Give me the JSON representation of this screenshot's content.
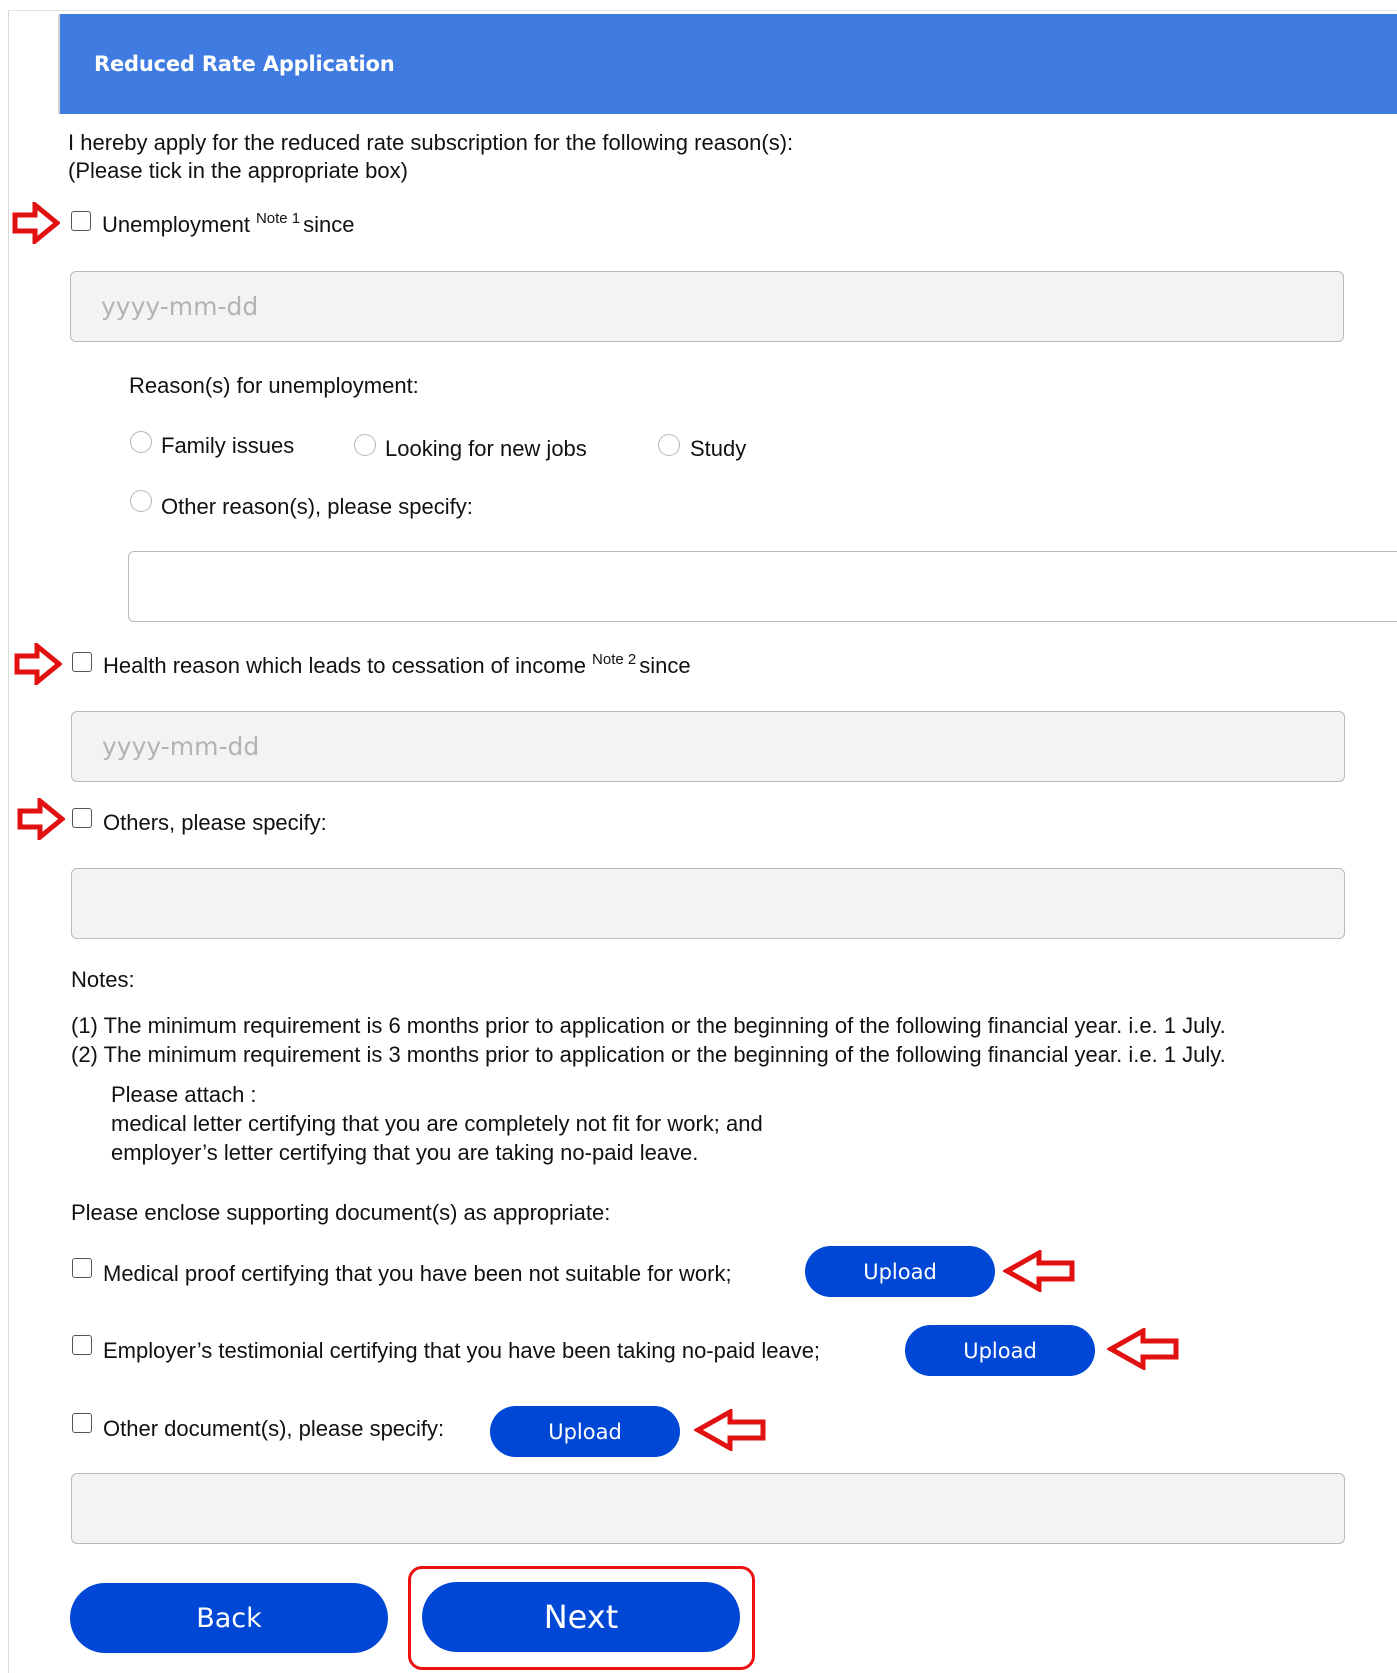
{
  "header": {
    "title": "Reduced Rate Application"
  },
  "intro": {
    "line1": "I hereby apply for the reduced rate subscription for the following reason(s):",
    "line2": "(Please tick in the appropriate box)"
  },
  "unemployment": {
    "label": "Unemployment",
    "note": "Note 1",
    "since": "since",
    "date_placeholder": "yyyy-mm-dd",
    "reasons_heading": "Reason(s) for unemployment:",
    "options": [
      "Family issues",
      "Looking for new jobs",
      "Study",
      "Other reason(s), please specify:"
    ],
    "other_value": ""
  },
  "health": {
    "label": "Health reason which leads to cessation of income",
    "note": "Note 2",
    "since": "since",
    "date_placeholder": "yyyy-mm-dd"
  },
  "others": {
    "label": "Others, please specify:",
    "value": ""
  },
  "notes": {
    "heading": "Notes:",
    "note1": "(1) The minimum requirement is 6 months prior to application or the beginning of the following financial year. i.e. 1 July.",
    "note2": "(2) The minimum requirement is 3 months prior to application or the beginning of the following financial year. i.e. 1 July.",
    "attach_heading": "Please attach :",
    "attach1": "medical letter certifying that you are completely not fit for work; and",
    "attach2": "employer’s letter certifying that you are taking no-paid leave."
  },
  "documents": {
    "heading": "Please enclose supporting document(s) as appropriate:",
    "medical": "Medical proof certifying that you have been not suitable for work;",
    "employer": "Employer’s testimonial certifying that you have been taking no-paid leave;",
    "other": "Other document(s), please specify:",
    "upload_label": "Upload",
    "other_value": ""
  },
  "actions": {
    "back": "Back",
    "next": "Next"
  },
  "colors": {
    "header": "#3f7be0",
    "button": "#0047d6",
    "arrow": "#e11111"
  }
}
